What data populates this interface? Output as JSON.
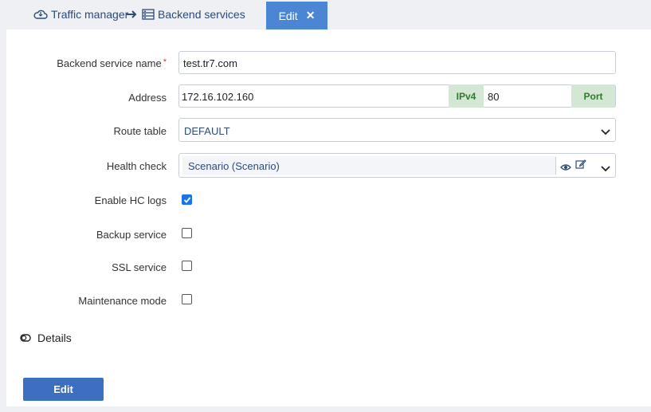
{
  "breadcrumb": {
    "traffic_manager": "Traffic manager",
    "backend_services": "Backend services"
  },
  "tab": {
    "edit_label": "Edit",
    "close_glyph": "✕"
  },
  "form": {
    "name_label": "Backend service name",
    "name_required_mark": "*",
    "name_value": "test.tr7.com",
    "address_label": "Address",
    "address_ip": "172.16.102.160",
    "ip_version_label": "IPv4",
    "port_value": "80",
    "port_label": "Port",
    "route_table_label": "Route table",
    "route_table_value": "DEFAULT",
    "health_check_label": "Health check",
    "health_check_value": "Scenario (Scenario)",
    "enable_hc_logs_label": "Enable HC logs",
    "enable_hc_logs_checked": true,
    "backup_service_label": "Backup service",
    "backup_service_checked": false,
    "ssl_service_label": "SSL service",
    "ssl_service_checked": false,
    "maintenance_mode_label": "Maintenance mode",
    "maintenance_mode_checked": false
  },
  "details_label": "Details",
  "submit_label": "Edit",
  "colors": {
    "accent": "#4a86d4",
    "button": "#3d6fc0",
    "addon_bg": "#d4e6d4",
    "addon_text": "#2e7d2e",
    "checkbox_checked": "#1a73e8"
  },
  "icons": {
    "breadcrumb_1": "cloud-icon",
    "breadcrumb_2": "server-list-icon",
    "arrow": "arrow-right-icon",
    "view": "eye-icon",
    "edit": "pencil-icon",
    "expand": "chevron-down-icon",
    "details": "toggle-icon"
  }
}
